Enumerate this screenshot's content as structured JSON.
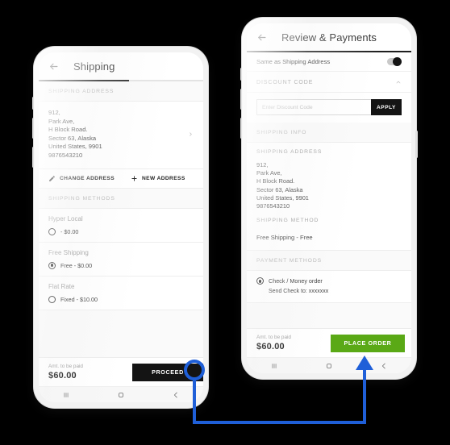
{
  "shipping_screen": {
    "title": "Shipping",
    "back_icon": "arrow-left-icon",
    "progress_percent": 55,
    "address_section_label": "SHIPPING ADDRESS",
    "address_lines": [
      "912,",
      "Park Ave,",
      "H Block Road.",
      "Sector 63, Alaska",
      "United States, 9901",
      "9876543210"
    ],
    "address_chevron_icon": "chevron-right-icon",
    "change_address_label": "CHANGE ADDRESS",
    "change_address_icon": "pencil-icon",
    "new_address_label": "NEW ADDRESS",
    "new_address_icon": "plus-icon",
    "methods_section_label": "SHIPPING METHODS",
    "methods": [
      {
        "name": "Hyper Local",
        "option": "- $0.00",
        "selected": false
      },
      {
        "name": "Free Shipping",
        "option": "Free - $0.00",
        "selected": true
      },
      {
        "name": "Flat Rate",
        "option": "Fixed - $10.00",
        "selected": false
      }
    ],
    "amount_label": "Amt. to be paid",
    "amount_value": "$60.00",
    "cta_label": "PROCEED"
  },
  "review_screen": {
    "title": "Review & Payments",
    "back_icon": "arrow-left-icon",
    "progress_percent": 100,
    "same_as_shipping_label": "Same as Shipping Address",
    "same_as_shipping_on": true,
    "discount_section_label": "DISCOUNT CODE",
    "discount_collapse_icon": "chevron-up-icon",
    "discount_placeholder": "Enter Discount Code",
    "discount_value": "",
    "apply_label": "APPLY",
    "shipping_info_label": "SHIPPING INFO",
    "address_section_label": "SHIPPING ADDRESS",
    "address_lines": [
      "912,",
      "Park Ave,",
      "H Block Road.",
      "Sector 63, Alaska",
      "United States, 9901",
      "9876543210"
    ],
    "shipping_method_label": "SHIPPING METHOD",
    "shipping_method_value": "Free Shipping - Free",
    "payment_section_label": "PAYMENT METHODS",
    "payment_option": "Check / Money order",
    "payment_option_selected": true,
    "payment_sub": "Send Check to: xxxxxxx",
    "amount_label": "Amt. to be paid",
    "amount_value": "$60.00",
    "cta_label": "PLACE ORDER"
  },
  "navbar": {
    "recents_icon": "recents-icon",
    "home_icon": "home-circle-icon",
    "back_icon": "chevron-left-icon"
  },
  "annotation": {
    "marker_icon": "highlight-circle-icon",
    "arrow_icon": "arrow-up-icon"
  },
  "colors": {
    "background": "#000000",
    "accent_dark": "#141414",
    "cta_green": "#5aa916",
    "annotation_blue": "#1f5fd8",
    "muted_text": "#b4b4b4"
  }
}
